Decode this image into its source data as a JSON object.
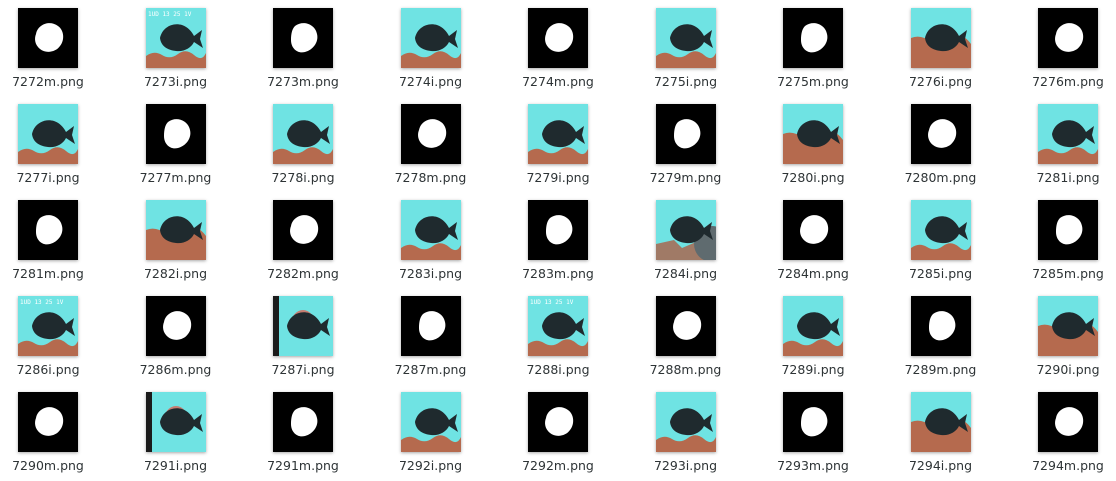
{
  "files": [
    {
      "name": "7272m.png",
      "type": "mask"
    },
    {
      "name": "7273i.png",
      "type": "image",
      "scene": "stamp"
    },
    {
      "name": "7273m.png",
      "type": "mask"
    },
    {
      "name": "7274i.png",
      "type": "image",
      "scene": "reef"
    },
    {
      "name": "7274m.png",
      "type": "mask"
    },
    {
      "name": "7275i.png",
      "type": "image",
      "scene": "reef"
    },
    {
      "name": "7275m.png",
      "type": "mask"
    },
    {
      "name": "7276i.png",
      "type": "image",
      "scene": "deep"
    },
    {
      "name": "7276m.png",
      "type": "mask"
    },
    {
      "name": "7277i.png",
      "type": "image",
      "scene": "reef"
    },
    {
      "name": "7277m.png",
      "type": "mask"
    },
    {
      "name": "7278i.png",
      "type": "image",
      "scene": "reef"
    },
    {
      "name": "7278m.png",
      "type": "mask"
    },
    {
      "name": "7279i.png",
      "type": "image",
      "scene": "reef"
    },
    {
      "name": "7279m.png",
      "type": "mask"
    },
    {
      "name": "7280i.png",
      "type": "image",
      "scene": "deep"
    },
    {
      "name": "7280m.png",
      "type": "mask"
    },
    {
      "name": "7281i.png",
      "type": "image",
      "scene": "reef"
    },
    {
      "name": "7281m.png",
      "type": "mask"
    },
    {
      "name": "7282i.png",
      "type": "image",
      "scene": "deep"
    },
    {
      "name": "7282m.png",
      "type": "mask"
    },
    {
      "name": "7283i.png",
      "type": "image",
      "scene": "reef"
    },
    {
      "name": "7283m.png",
      "type": "mask"
    },
    {
      "name": "7284i.png",
      "type": "image",
      "scene": "rock"
    },
    {
      "name": "7284m.png",
      "type": "mask"
    },
    {
      "name": "7285i.png",
      "type": "image",
      "scene": "reef"
    },
    {
      "name": "7285m.png",
      "type": "mask"
    },
    {
      "name": "7286i.png",
      "type": "image",
      "scene": "stamp"
    },
    {
      "name": "7286m.png",
      "type": "mask"
    },
    {
      "name": "7287i.png",
      "type": "image",
      "scene": "blur"
    },
    {
      "name": "7287m.png",
      "type": "mask"
    },
    {
      "name": "7288i.png",
      "type": "image",
      "scene": "stamp"
    },
    {
      "name": "7288m.png",
      "type": "mask"
    },
    {
      "name": "7289i.png",
      "type": "image",
      "scene": "reef"
    },
    {
      "name": "7289m.png",
      "type": "mask"
    },
    {
      "name": "7290i.png",
      "type": "image",
      "scene": "deep"
    },
    {
      "name": "7290m.png",
      "type": "mask"
    },
    {
      "name": "7291i.png",
      "type": "image",
      "scene": "blur"
    },
    {
      "name": "7291m.png",
      "type": "mask"
    },
    {
      "name": "7292i.png",
      "type": "image",
      "scene": "reef"
    },
    {
      "name": "7292m.png",
      "type": "mask"
    },
    {
      "name": "7293i.png",
      "type": "image",
      "scene": "reef"
    },
    {
      "name": "7293m.png",
      "type": "mask"
    },
    {
      "name": "7294i.png",
      "type": "image",
      "scene": "deep"
    },
    {
      "name": "7294m.png",
      "type": "mask"
    }
  ],
  "stamp_text": "1UD 13 25 1V",
  "colors": {
    "water": "#6fe3e3",
    "reef": "#b56a4e",
    "fish": "#1f2a2e",
    "mask_bg": "#000000",
    "mask_fg": "#ffffff"
  }
}
